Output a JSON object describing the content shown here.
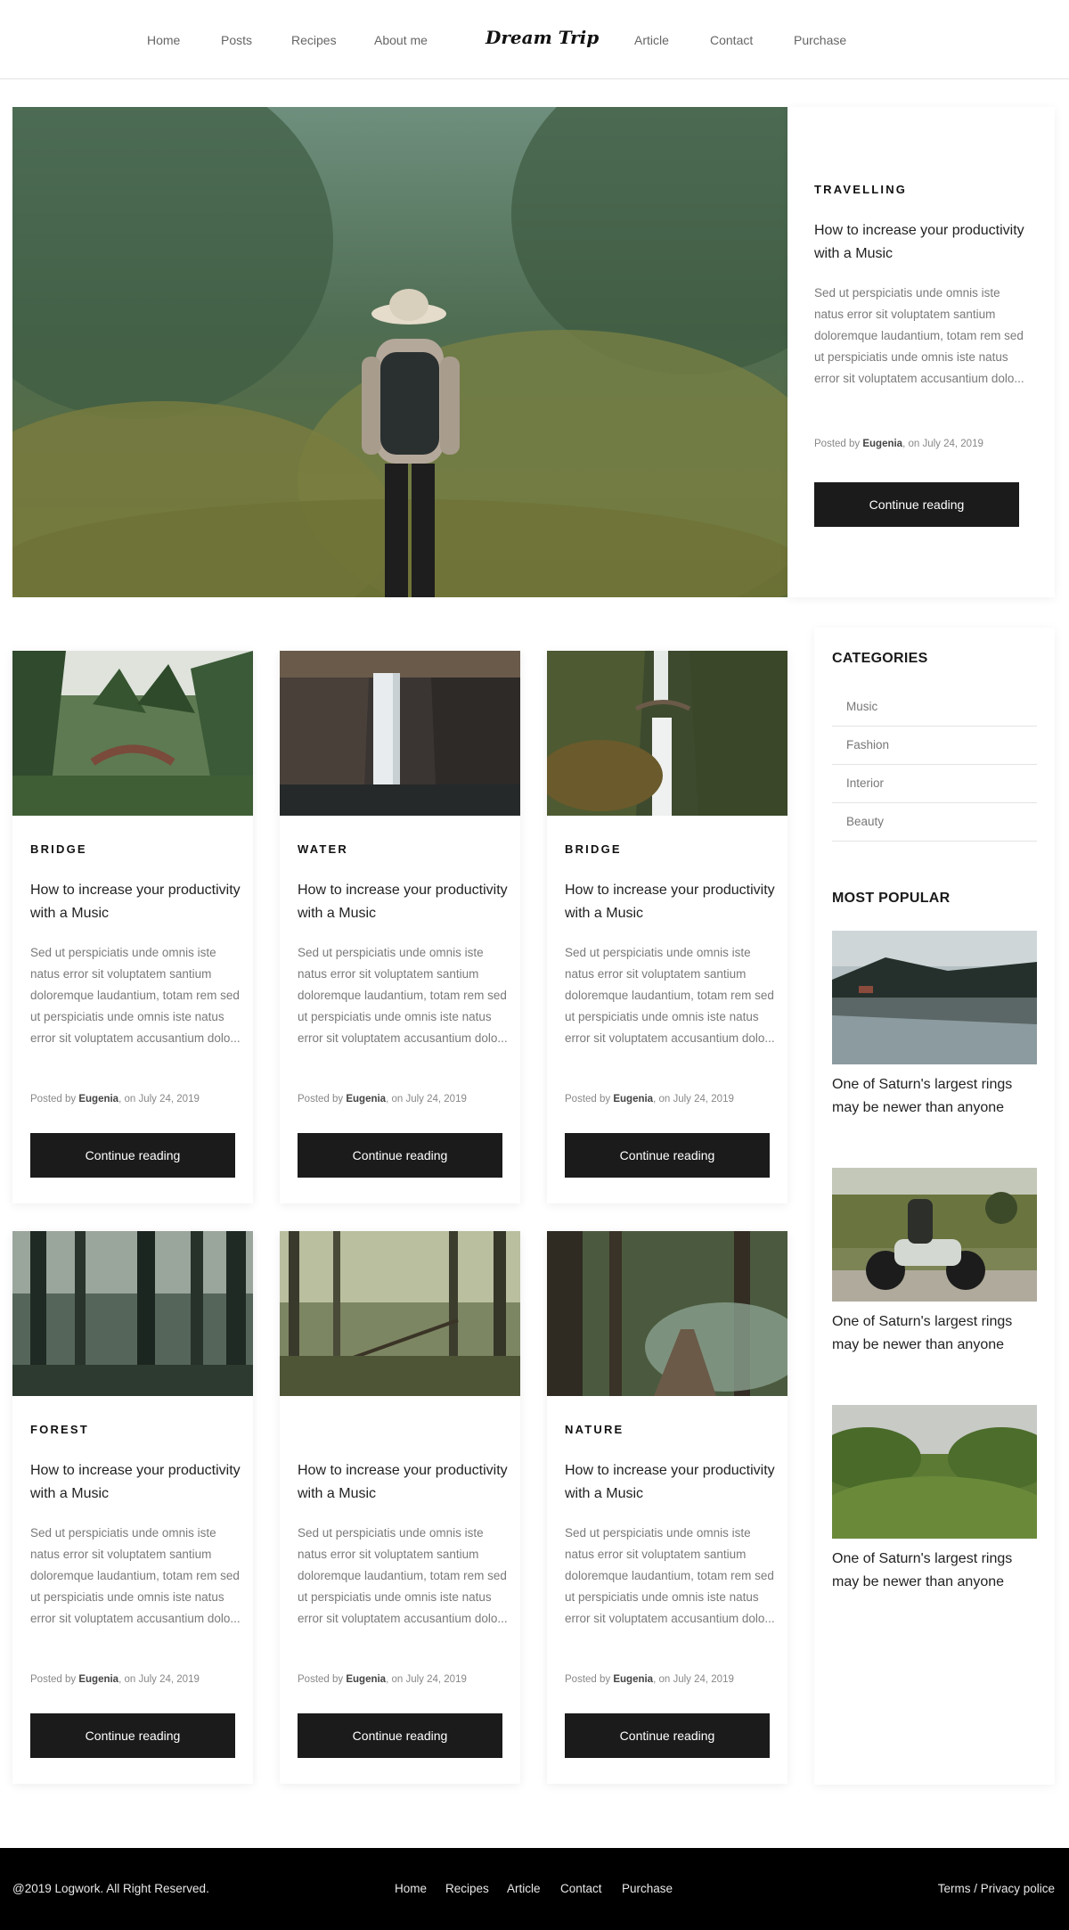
{
  "header": {
    "brand": "Dream Trip",
    "nav_left": [
      "Home",
      "Posts",
      "Recipes",
      "About me"
    ],
    "nav_right": [
      "Article",
      "Contact",
      "Purchase"
    ]
  },
  "hero": {
    "category": "TRAVELLING",
    "title": "How to increase your productivity with a Music",
    "excerpt": "Sed ut perspiciatis unde omnis iste natus error sit voluptatem santium doloremque laudantium, totam rem sed ut perspiciatis unde omnis iste natus error sit voluptatem accusantium dolo...",
    "meta_prefix": "Posted by ",
    "author": "Eugenia",
    "meta_suffix": ", on July  24, 2019",
    "button": "Continue reading"
  },
  "posts": [
    {
      "category": "BRIDGE",
      "title": "How to increase your productivity with a Music",
      "excerpt": "Sed ut perspiciatis unde omnis iste natus error sit voluptatem santium doloremque laudantium, totam rem sed ut perspiciatis unde omnis iste natus error sit voluptatem accusantium dolo...",
      "meta_prefix": "Posted by ",
      "author": "Eugenia",
      "meta_suffix": ", on July  24, 2019",
      "button": "Continue reading"
    },
    {
      "category": "WATER",
      "title": "How to increase your productivity with a Music",
      "excerpt": "Sed ut perspiciatis unde omnis iste natus error sit voluptatem santium doloremque laudantium, totam rem sed ut perspiciatis unde omnis iste natus error sit voluptatem accusantium dolo...",
      "meta_prefix": "Posted by ",
      "author": "Eugenia",
      "meta_suffix": ", on July  24, 2019",
      "button": "Continue reading"
    },
    {
      "category": "BRIDGE",
      "title": "How to increase your productivity with a Music",
      "excerpt": "Sed ut perspiciatis unde omnis iste natus error sit voluptatem santium doloremque laudantium, totam rem sed ut perspiciatis unde omnis iste natus error sit voluptatem accusantium dolo...",
      "meta_prefix": "Posted by ",
      "author": "Eugenia",
      "meta_suffix": ", on July  24, 2019",
      "button": "Continue reading"
    },
    {
      "category": "FOREST",
      "title": "How to increase your productivity with a Music",
      "excerpt": "Sed ut perspiciatis unde omnis iste natus error sit voluptatem santium doloremque laudantium, totam rem sed ut perspiciatis unde omnis iste natus error sit voluptatem accusantium dolo...",
      "meta_prefix": "Posted by ",
      "author": "Eugenia",
      "meta_suffix": ", on July  24, 2019",
      "button": "Continue reading"
    },
    {
      "category": "",
      "title": "How to increase your productivity with a Music",
      "excerpt": "Sed ut perspiciatis unde omnis iste natus error sit voluptatem santium doloremque laudantium, totam rem sed ut perspiciatis unde omnis iste natus error sit voluptatem accusantium dolo...",
      "meta_prefix": "Posted by ",
      "author": "Eugenia",
      "meta_suffix": ", on July  24, 2019",
      "button": "Continue reading"
    },
    {
      "category": "NATURE",
      "title": "How to increase your productivity with a Music",
      "excerpt": "Sed ut perspiciatis unde omnis iste natus error sit voluptatem santium doloremque laudantium, totam rem sed ut perspiciatis unde omnis iste natus error sit voluptatem accusantium dolo...",
      "meta_prefix": "Posted by ",
      "author": "Eugenia",
      "meta_suffix": ", on July  24, 2019",
      "button": "Continue reading"
    }
  ],
  "sidebar": {
    "categories_heading": "CATEGORIES",
    "categories": [
      "Music",
      "Fashion",
      "Interior",
      "Beauty"
    ],
    "popular_heading": "MOST POPULAR",
    "popular": [
      {
        "title": "One of Saturn's largest rings may be newer than anyone"
      },
      {
        "title": "One of Saturn's largest rings may be newer than anyone"
      },
      {
        "title": "One of Saturn's largest rings may be newer than anyone"
      }
    ]
  },
  "footer": {
    "copyright": "@2019 Logwork. All Right Reserved.",
    "links": [
      "Home",
      "Recipes",
      "Article",
      "Contact",
      "Purchase"
    ],
    "legal": "Terms / Privacy police"
  },
  "colors": {
    "button_bg": "#1b1b1b",
    "footer_bg": "#000000",
    "text_muted": "#7a7a7a"
  }
}
